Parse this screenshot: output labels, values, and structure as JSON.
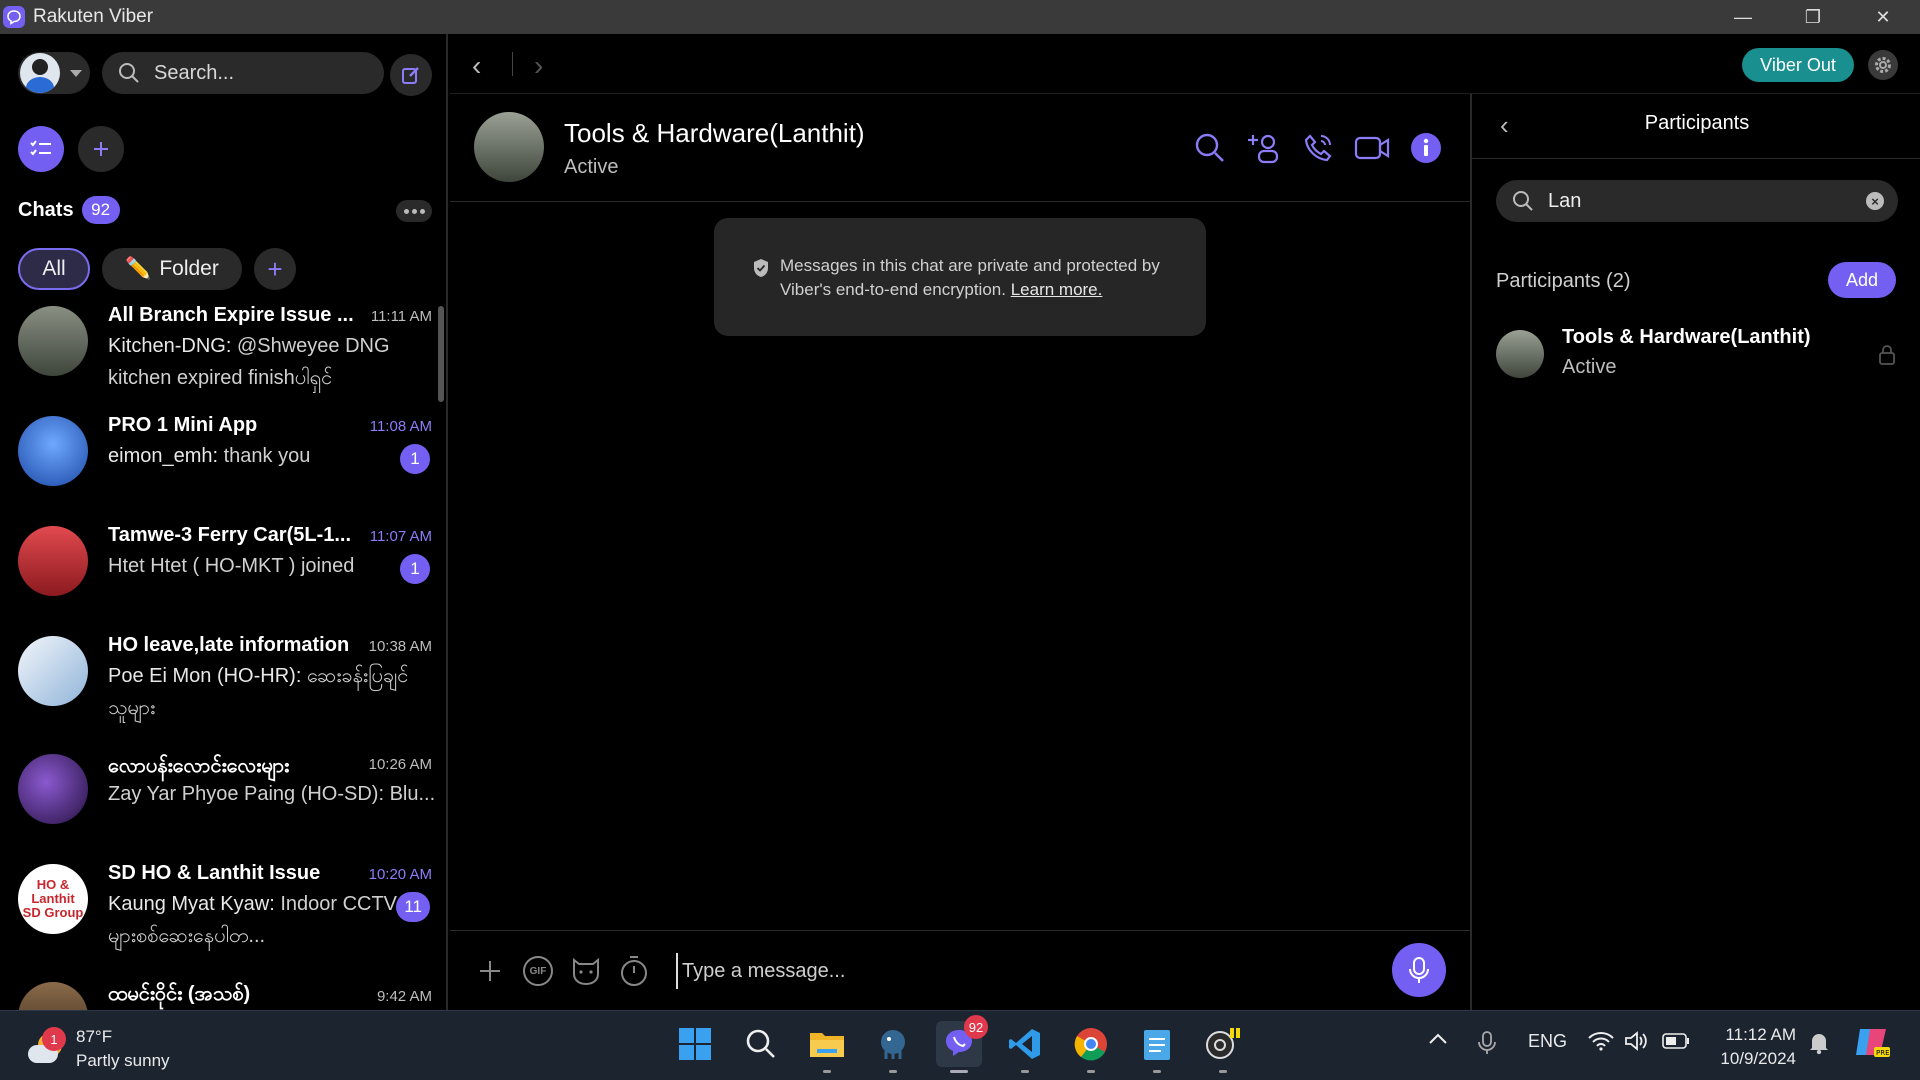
{
  "window": {
    "title": "Rakuten Viber",
    "controls": {
      "minimize": "—",
      "restore": "❐",
      "close": "✕"
    }
  },
  "sidebar": {
    "search_placeholder": "Search...",
    "chats_label": "Chats",
    "chats_count": "92",
    "filters": {
      "all": "All",
      "folder": "Folder"
    },
    "chats": [
      {
        "name": "All Branch Expire Issue ...",
        "time": "11:11 AM",
        "sender": "Kitchen-DNG:",
        "message": "@Shweyee DNG kitchen expired finishပါရှင်",
        "unread": "",
        "avatar_color": "#6d7b6a"
      },
      {
        "name": "PRO 1 Mini App",
        "time": "11:08 AM",
        "sender": "eimon_emh:",
        "message": "thank you",
        "unread": "1",
        "avatar_color": "#2a63c9"
      },
      {
        "name": "Tamwe-3 Ferry Car(5L-1...",
        "time": "11:07 AM",
        "sender": "",
        "message": "Htet Htet ( HO-MKT ) joined",
        "unread": "1",
        "avatar_color": "#c8262e"
      },
      {
        "name": "HO leave,late information",
        "time": "10:38 AM",
        "sender": "Poe Ei Mon (HO-HR):",
        "message": "ဆေးခန်းပြချင်သူများ",
        "unread": "",
        "avatar_color": "#dfe8f2"
      },
      {
        "name": "လောပန်းလောင်းလေးများ",
        "time": "10:26 AM",
        "sender": "",
        "message": "Zay Yar Phyoe Paing (HO-SD): Blu...",
        "unread": "",
        "avatar_color": "#4a2a7a"
      },
      {
        "name": "SD HO & Lanthit Issue",
        "time": "10:20 AM",
        "sender": "Kaung Myat Kyaw:",
        "message": "Indoor CCTV များစစ်ဆေးနေပါတ...",
        "unread": "11",
        "avatar_color": "#ffffff"
      },
      {
        "name": "ထမင်းဝိုင်း (အသစ်)",
        "time": "9:42 AM",
        "sender": "",
        "message": "",
        "unread": "",
        "avatar_color": "#7a5a3a"
      }
    ]
  },
  "topbar": {
    "viber_out": "Viber Out"
  },
  "chat": {
    "title": "Tools & Hardware(Lanthit)",
    "status": "Active",
    "encryption_notice": "Messages in this chat are private and protected by Viber's end-to-end encryption.",
    "learn_more": "Learn more.",
    "composer_placeholder": "Type a message...",
    "gif_label": "GIF"
  },
  "participants_panel": {
    "title": "Participants",
    "search_value": "Lan",
    "count_label": "Participants (2)",
    "add_label": "Add",
    "items": [
      {
        "name": "Tools & Hardware(Lanthit)",
        "status": "Active"
      }
    ]
  },
  "taskbar": {
    "weather_temp": "87°F",
    "weather_desc": "Partly sunny",
    "weather_badge": "1",
    "viber_badge": "92",
    "language": "ENG",
    "time": "11:12 AM",
    "date": "10/9/2024"
  },
  "colors": {
    "accent": "#7360f2",
    "viber_out": "#1a8f8f",
    "background": "#000000",
    "panel": "#2a2a2a"
  }
}
